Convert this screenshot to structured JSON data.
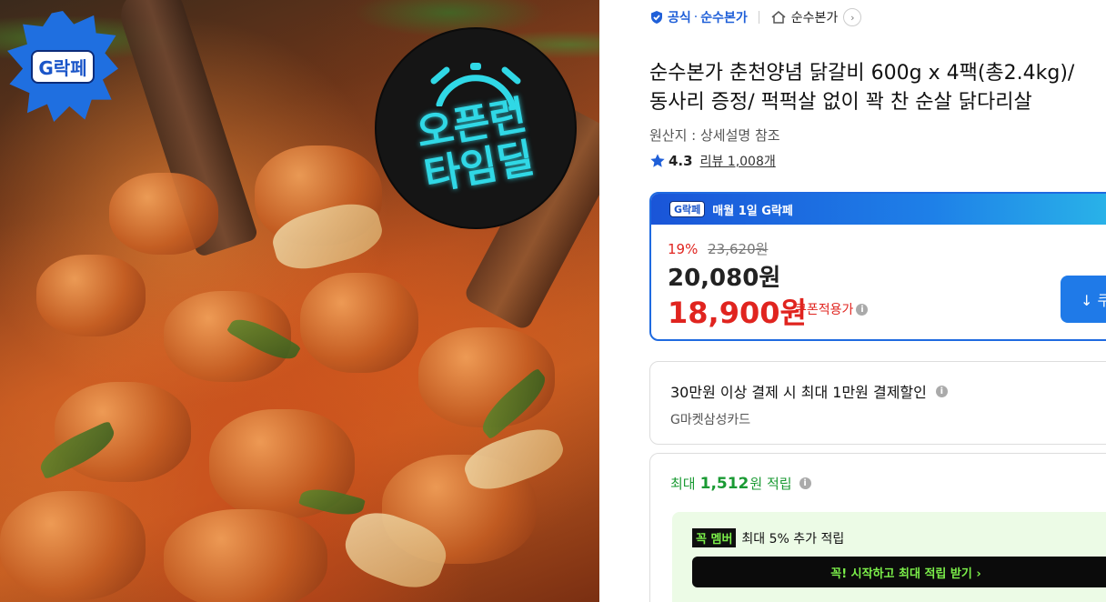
{
  "hero": {
    "badge_label": "G락페",
    "deal_label_line1": "오픈런",
    "deal_label_line2": "타임딜"
  },
  "brand": {
    "official_label": "공식",
    "separator": "·",
    "brand_name": "순수본가",
    "store_name": "순수본가",
    "store_arrow": "›"
  },
  "product": {
    "title_line1": "순수본가 춘천양념 닭갈비 600g x 4팩(총2.4kg)/",
    "title_line2": "동사리 증정/ 퍽퍽살 없이 꽉 찬 순살 닭다리살",
    "origin": "원산지 : 상세설명 참조",
    "rating_value": "4.3",
    "review_label": "리뷰 1,008개"
  },
  "price": {
    "header_badge": "G락페",
    "header_label": "매월 1일 G락페",
    "discount_rate": "19%",
    "original_price": "23,620원",
    "sale_price": "20,080원",
    "coupon_price": "18,900원",
    "coupon_label": "쿠폰적용가",
    "download_label": "↓ 쿠"
  },
  "card_promo": {
    "text": "30만원 이상 결제 시 최대 1만원 결제할인",
    "card_name": "G마켓삼성카드"
  },
  "points": {
    "prefix": "최대",
    "amount": "1,512",
    "suffix": "원 적립",
    "member_badge": "꼭 멤버",
    "member_text": "최대 5% 추가 적립",
    "cta_label": "꼭! 시작하고 최대 적립 받기  ›"
  },
  "colors": {
    "accent_blue": "#1f6ae0",
    "price_red": "#e0241f",
    "point_green": "#1a9a33",
    "deal_cyan": "#30d8e6"
  }
}
